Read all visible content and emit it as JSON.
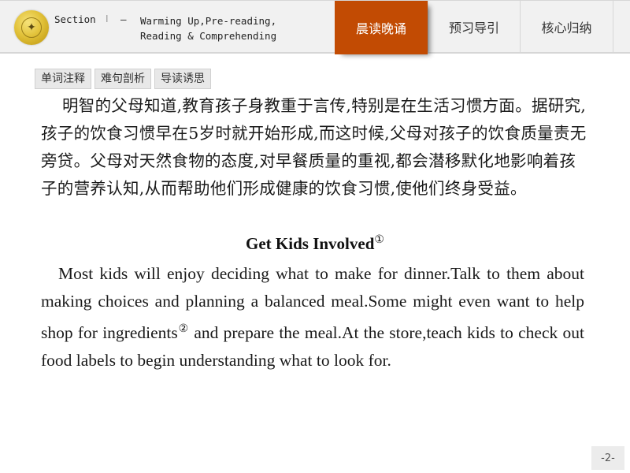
{
  "header": {
    "logo_icon": "school-emblem-icon",
    "section_label": "Section",
    "section_numeral": "Ⅰ",
    "section_dash": "—",
    "section_title_line1": "Warming Up,Pre-reading,",
    "section_title_line2": "Reading & Comprehending",
    "tabs": [
      {
        "label": "晨读晚诵",
        "active": true
      },
      {
        "label": "预习导引",
        "active": false
      },
      {
        "label": "核心归纳",
        "active": false
      },
      {
        "label": "",
        "active": false
      }
    ],
    "accent_color": "#c24b03"
  },
  "subtabs": [
    {
      "label": "单词注释"
    },
    {
      "label": "难句剖析"
    },
    {
      "label": "导读诱思"
    }
  ],
  "content": {
    "chinese_paragraph": "明智的父母知道,教育孩子身教重于言传,特别是在生活习惯方面。据研究,孩子的饮食习惯早在5岁时就开始形成,而这时候,父母对孩子的饮食质量责无旁贷。父母对天然食物的态度,对早餐质量的重视,都会潜移默化地影响着孩子的营养认知,从而帮助他们形成健康的饮食习惯,使他们终身受益。",
    "english_title": "Get Kids Involved",
    "english_title_note": "①",
    "english_para_part1": "Most kids will enjoy deciding what to make for dinner.Talk to them about making choices and planning a balanced meal.Some might even want to help shop for ingredients",
    "english_para_note": "②",
    "english_para_part2": " and prepare the meal.At the store,teach kids to check out food labels to begin understanding what to look for."
  },
  "footer": {
    "page_number": "-2-"
  }
}
